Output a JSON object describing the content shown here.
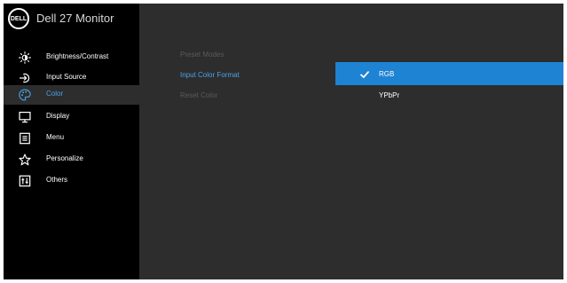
{
  "brand": {
    "logo_text": "DELL",
    "title": "Dell 27 Monitor"
  },
  "menu": {
    "items": [
      {
        "label": "Brightness/Contrast",
        "icon": "brightness-icon",
        "active": false
      },
      {
        "label": "Input Source",
        "icon": "input-source-icon",
        "active": false
      },
      {
        "label": "Color",
        "icon": "color-palette-icon",
        "active": true
      },
      {
        "label": "Display",
        "icon": "display-icon",
        "active": false
      },
      {
        "label": "Menu",
        "icon": "menu-icon",
        "active": false
      },
      {
        "label": "Personalize",
        "icon": "star-icon",
        "active": false
      },
      {
        "label": "Others",
        "icon": "others-icon",
        "active": false
      }
    ]
  },
  "color_submenu": {
    "options": [
      {
        "label": "Preset Modes",
        "state": "dimmed"
      },
      {
        "label": "Input Color Format",
        "state": "active"
      },
      {
        "label": "Reset Color",
        "state": "dimmed"
      }
    ]
  },
  "input_color_format": {
    "choices": [
      {
        "label": "RGB",
        "selected": true
      },
      {
        "label": "YPbPr",
        "selected": false
      }
    ]
  },
  "colors": {
    "sidebar_bg": "#000000",
    "panel_bg": "#2d2d2d",
    "accent": "#4aa3e8",
    "selection": "#1f83d3",
    "dimmed_text": "#5a5a5a"
  }
}
